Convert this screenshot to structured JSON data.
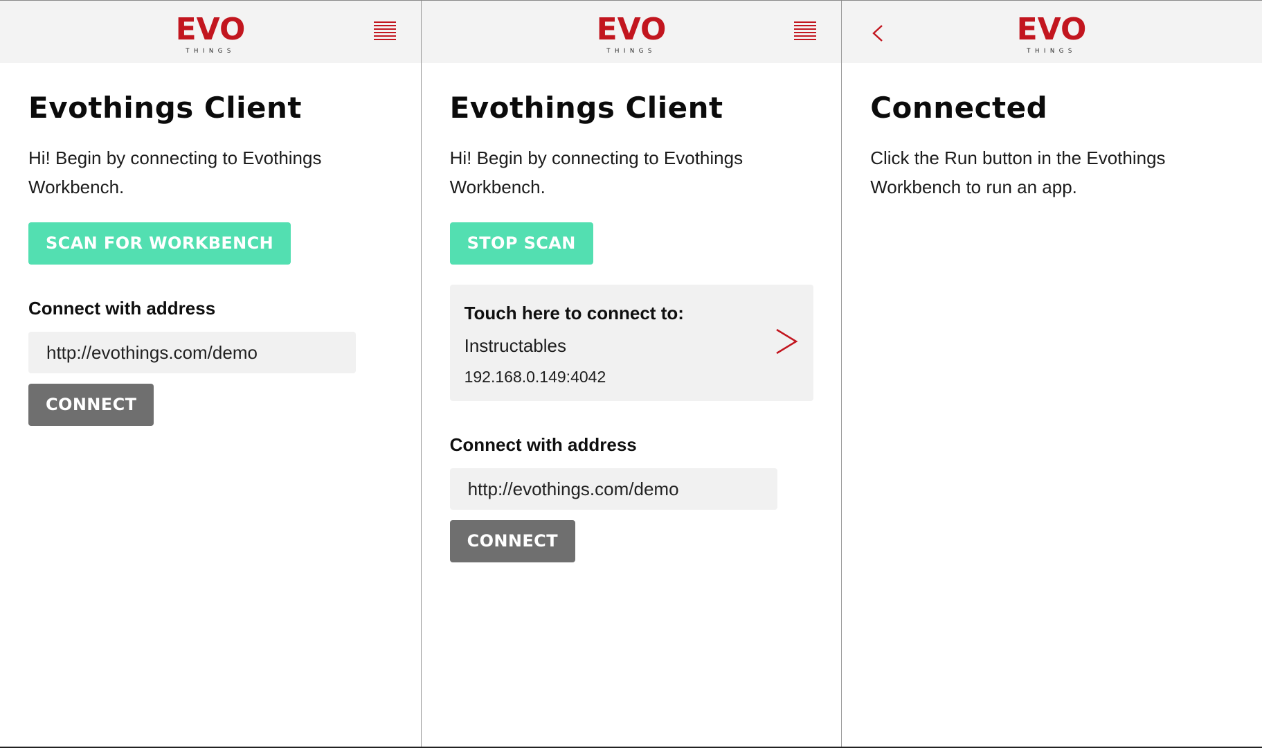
{
  "colors": {
    "brand_red": "#c2161f",
    "scan_green": "#53dfb1",
    "connect_gray": "#6f6f6f",
    "topbar_bg": "#f3f3f3",
    "field_bg": "#f1f1f1"
  },
  "logo": {
    "word": "EVO",
    "sub": "THINGS"
  },
  "icons": {
    "menu": "hamburger-menu-icon",
    "back": "chevron-left-icon",
    "card_arrow": "chevron-right-icon"
  },
  "panels": [
    {
      "title": "Evothings Client",
      "intro": "Hi! Begin by connecting to Evothings Workbench.",
      "primary_button": "SCAN FOR WORKBENCH",
      "address_label": "Connect with address",
      "address_value": "http://evothings.com/demo",
      "connect_button": "CONNECT"
    },
    {
      "title": "Evothings Client",
      "intro": "Hi! Begin by connecting to Evothings Workbench.",
      "primary_button": "STOP SCAN",
      "server": {
        "prompt": "Touch here to connect to:",
        "name": "Instructables",
        "address": "192.168.0.149:4042"
      },
      "address_label": "Connect with address",
      "address_value": "http://evothings.com/demo",
      "connect_button": "CONNECT"
    },
    {
      "title": "Connected",
      "intro": "Click the Run button in the Evothings Workbench to run an app."
    }
  ]
}
